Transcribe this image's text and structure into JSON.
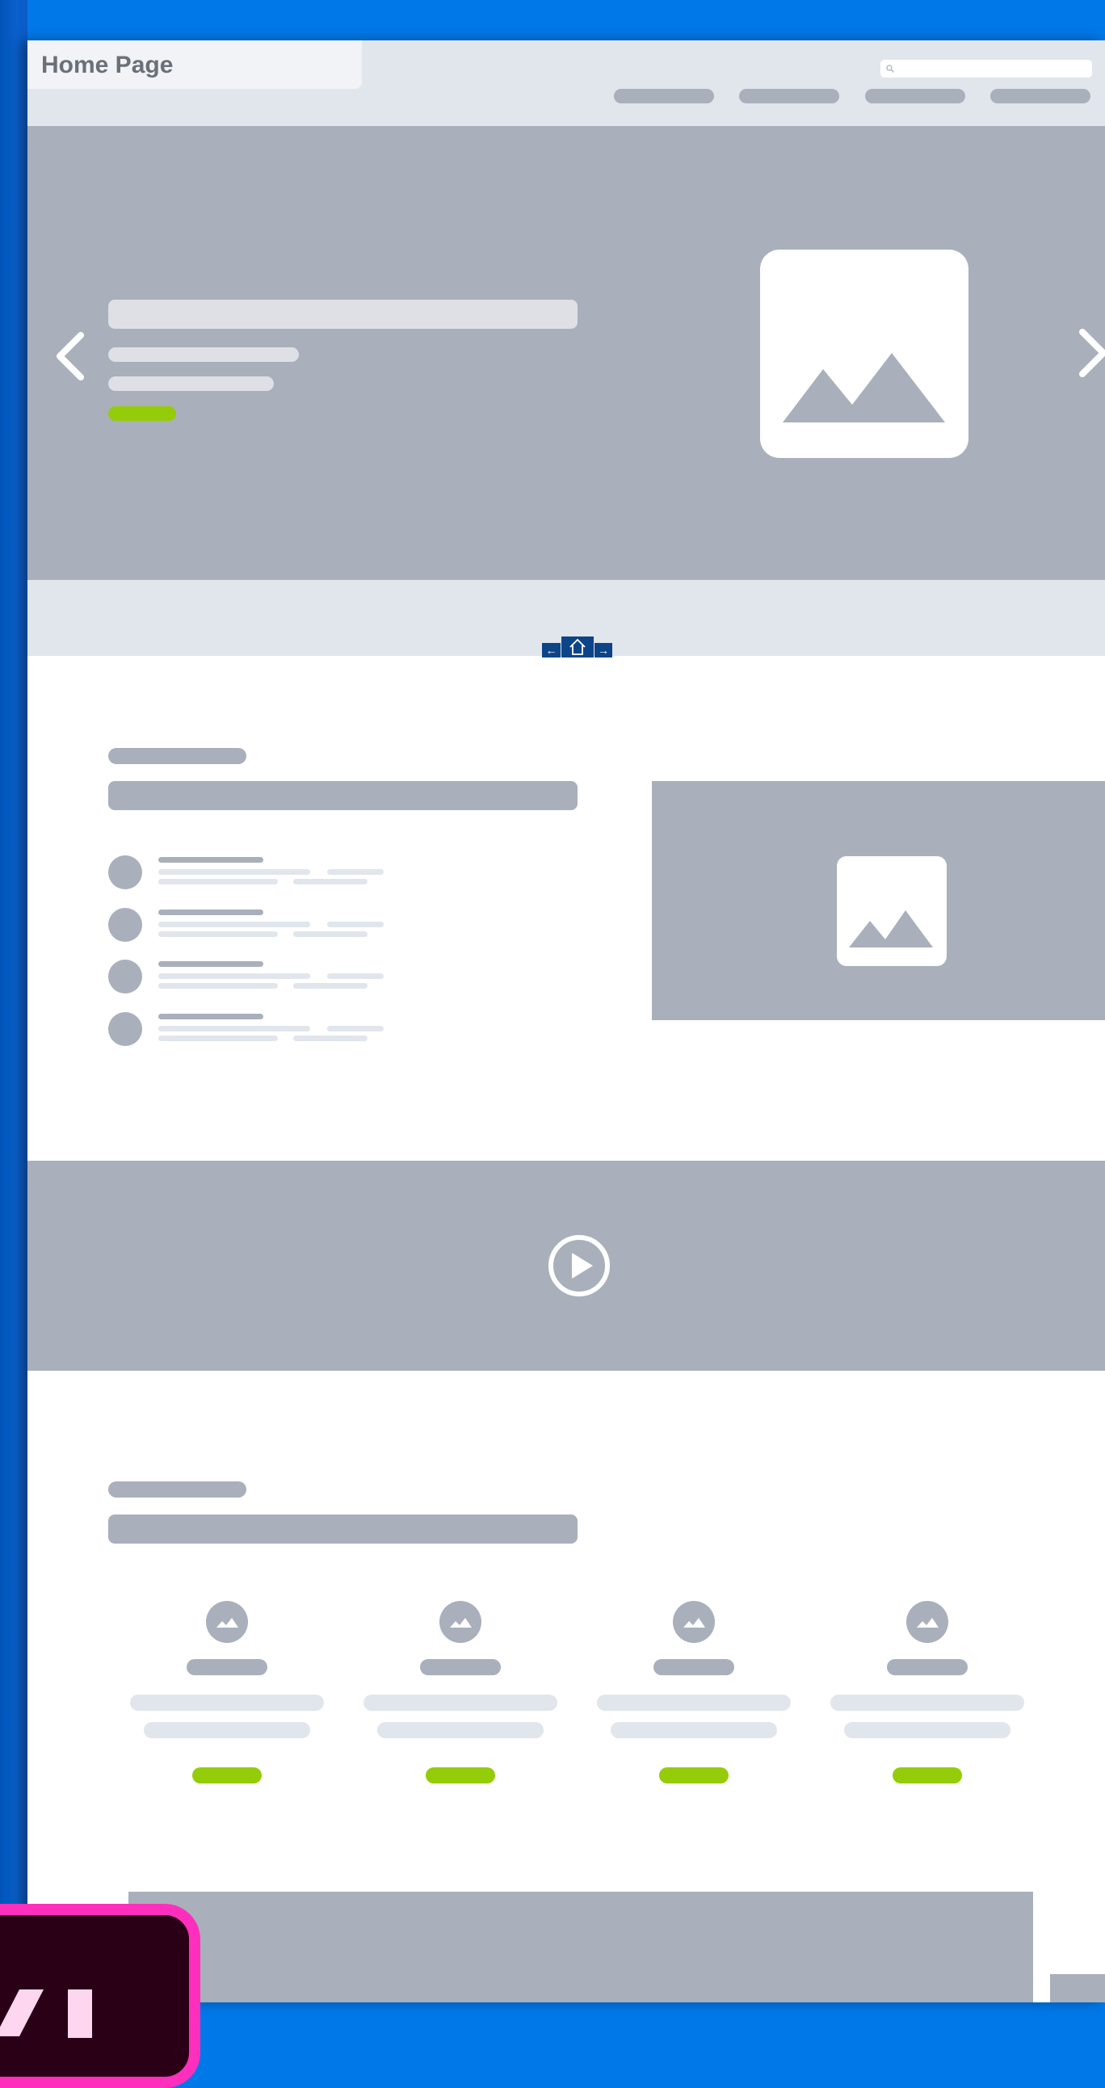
{
  "page": {
    "title": "Home Page"
  },
  "colors": {
    "canvas": "#0078e8",
    "header_bg": "#e1e5ec",
    "placeholder": "#a9afbb",
    "light_placeholder": "#e1e5ec",
    "accent_green": "#95cc0a",
    "page_nav": "#0d4488",
    "logo_border": "#ff2fbd",
    "logo_bg": "#2a0016"
  },
  "icons": {
    "search": "search-icon",
    "prev": "chevron-left-icon",
    "next": "chevron-right-icon",
    "image": "image-icon",
    "play": "play-icon",
    "home": "home-icon",
    "arrow_left": "arrow-left-icon",
    "arrow_right": "arrow-right-icon",
    "app_logo": "app-logo-icon"
  }
}
